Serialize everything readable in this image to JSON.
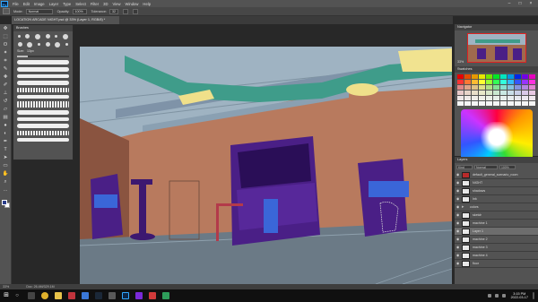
{
  "app": {
    "name": "Ps"
  },
  "menu": [
    "File",
    "Edit",
    "Image",
    "Layer",
    "Type",
    "Select",
    "Filter",
    "3D",
    "View",
    "Window",
    "Help"
  ],
  "options": {
    "mode_label": "Mode:",
    "mode_value": "Normal",
    "opacity_label": "Opacity:",
    "opacity_value": "100%",
    "tolerance_label": "Tolerance:",
    "tolerance_value": "32"
  },
  "document_tab": {
    "title": "LOCATION ARCADE NIGHT.psd @ 33% (Layer 1, RGB/8) *"
  },
  "panels": {
    "brushes": {
      "title": "Brushes",
      "size_label": "Size:",
      "size_value": "13px"
    },
    "navigator": {
      "title": "Navigator",
      "zoom": "33%"
    },
    "swatches": {
      "title": "Swatches"
    },
    "layers": {
      "title": "Layers",
      "kind_label": "Kind",
      "blend_mode": "Normal",
      "opacity_value": "100%",
      "items": [
        {
          "name": "default_general_scenario_room",
          "thumb": "red",
          "visible": true
        },
        {
          "name": "NIGHT",
          "thumb": "white",
          "visible": true
        },
        {
          "name": "shadows",
          "thumb": "white",
          "visible": true
        },
        {
          "name": "Ink",
          "thumb": "white",
          "visible": true
        },
        {
          "name": "colors",
          "thumb": "folder",
          "visible": true
        },
        {
          "name": "sketch",
          "thumb": "white",
          "visible": true
        },
        {
          "name": "machine 1",
          "thumb": "white",
          "visible": true
        },
        {
          "name": "Layer 1",
          "thumb": "white",
          "visible": true,
          "selected": true
        },
        {
          "name": "machine 2",
          "thumb": "white",
          "visible": true
        },
        {
          "name": "machine 3",
          "thumb": "white",
          "visible": true
        },
        {
          "name": "machine 4",
          "thumb": "white",
          "visible": true
        },
        {
          "name": "floor",
          "thumb": "white",
          "visible": true
        }
      ]
    }
  },
  "status_bar": {
    "zoom": "33%",
    "doc": "Doc: 26.4M/329.1M"
  },
  "taskbar": {
    "time": "3:15 PM",
    "date": "2022-03-17"
  },
  "colors": {
    "wall": "#b87a5e",
    "ceiling": "#9fb3c2",
    "duct": "#3f9c8a",
    "floor": "#6b7a86",
    "cabinet": "#4a1f86",
    "screen_blue": "#3a66d8"
  }
}
